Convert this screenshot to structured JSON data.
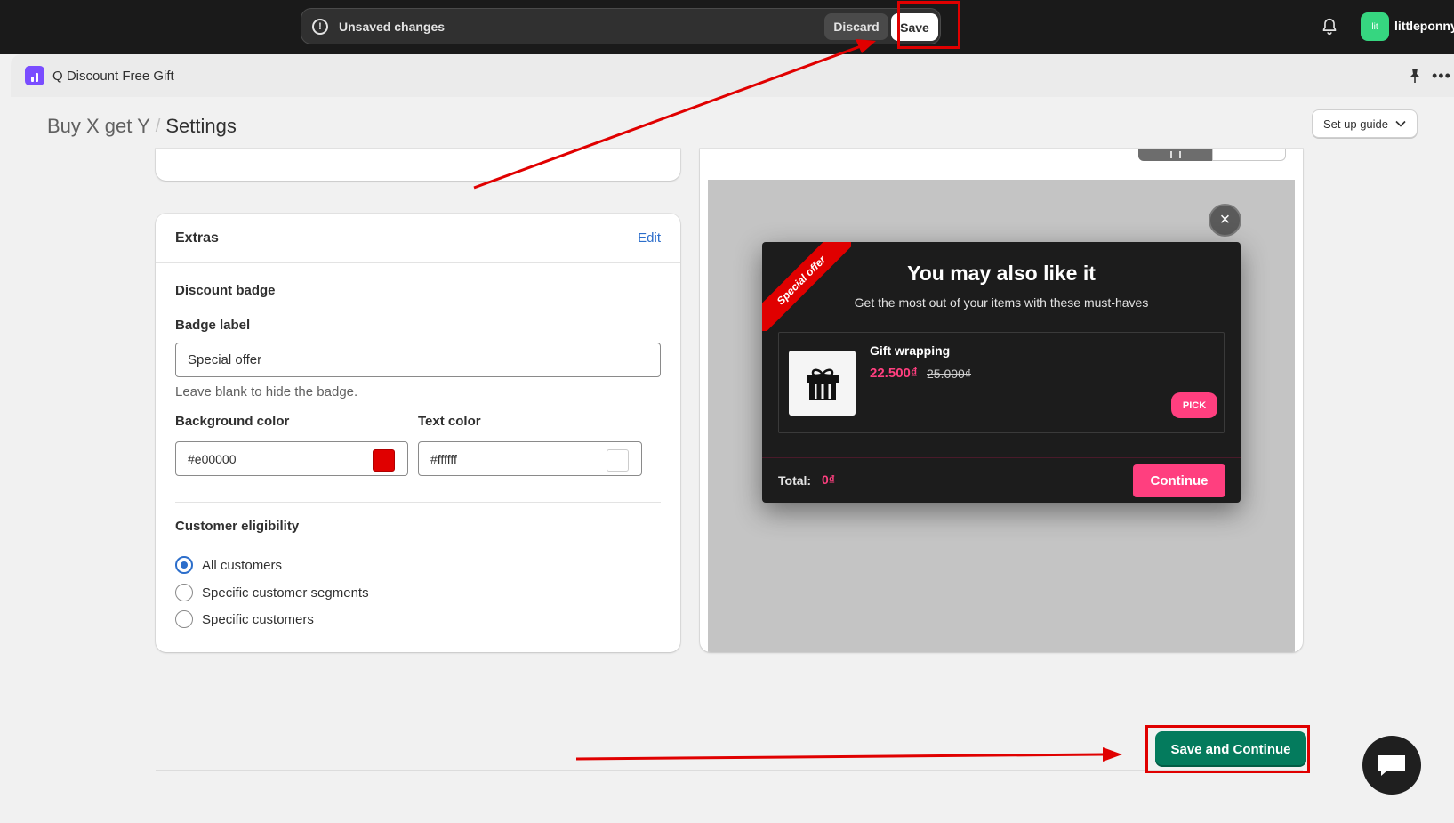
{
  "topbar": {
    "unsaved_text": "Unsaved changes",
    "discard_label": "Discard",
    "save_label": "Save",
    "avatar_initials": "lit",
    "store_name": "littleponny"
  },
  "app": {
    "name": "Q Discount Free Gift"
  },
  "header": {
    "breadcrumb_parent": "Buy X get Y",
    "breadcrumb_separator": "/",
    "title": "Settings",
    "setup_guide_label": "Set up guide"
  },
  "extras": {
    "title": "Extras",
    "edit_label": "Edit",
    "discount_badge_heading": "Discount badge",
    "badge_label_label": "Badge label",
    "badge_label_value": "Special offer",
    "badge_help": "Leave blank to hide the badge.",
    "bg_color_label": "Background color",
    "bg_color_value": "#e00000",
    "text_color_label": "Text color",
    "text_color_value": "#ffffff",
    "eligibility_heading": "Customer eligibility",
    "eligibility_options": [
      {
        "label": "All customers",
        "checked": true
      },
      {
        "label": "Specific customer segments",
        "checked": false
      },
      {
        "label": "Specific customers",
        "checked": false
      }
    ]
  },
  "preview": {
    "ribbon_text": "Special offer",
    "modal_title": "You may also like it",
    "modal_subtitle": "Get the most out of your items with these must-haves",
    "product_name": "Gift wrapping",
    "product_price": "22.500₫",
    "product_compare_price": "25.000₫",
    "pick_label": "PICK",
    "total_label": "Total:",
    "total_value": "0₫",
    "continue_label": "Continue",
    "close_glyph": "×"
  },
  "footer": {
    "save_continue_label": "Save and Continue"
  },
  "colors": {
    "brand_green": "#047b5d",
    "accent_pink": "#ff3f7f",
    "annotation_red": "#e00000"
  }
}
